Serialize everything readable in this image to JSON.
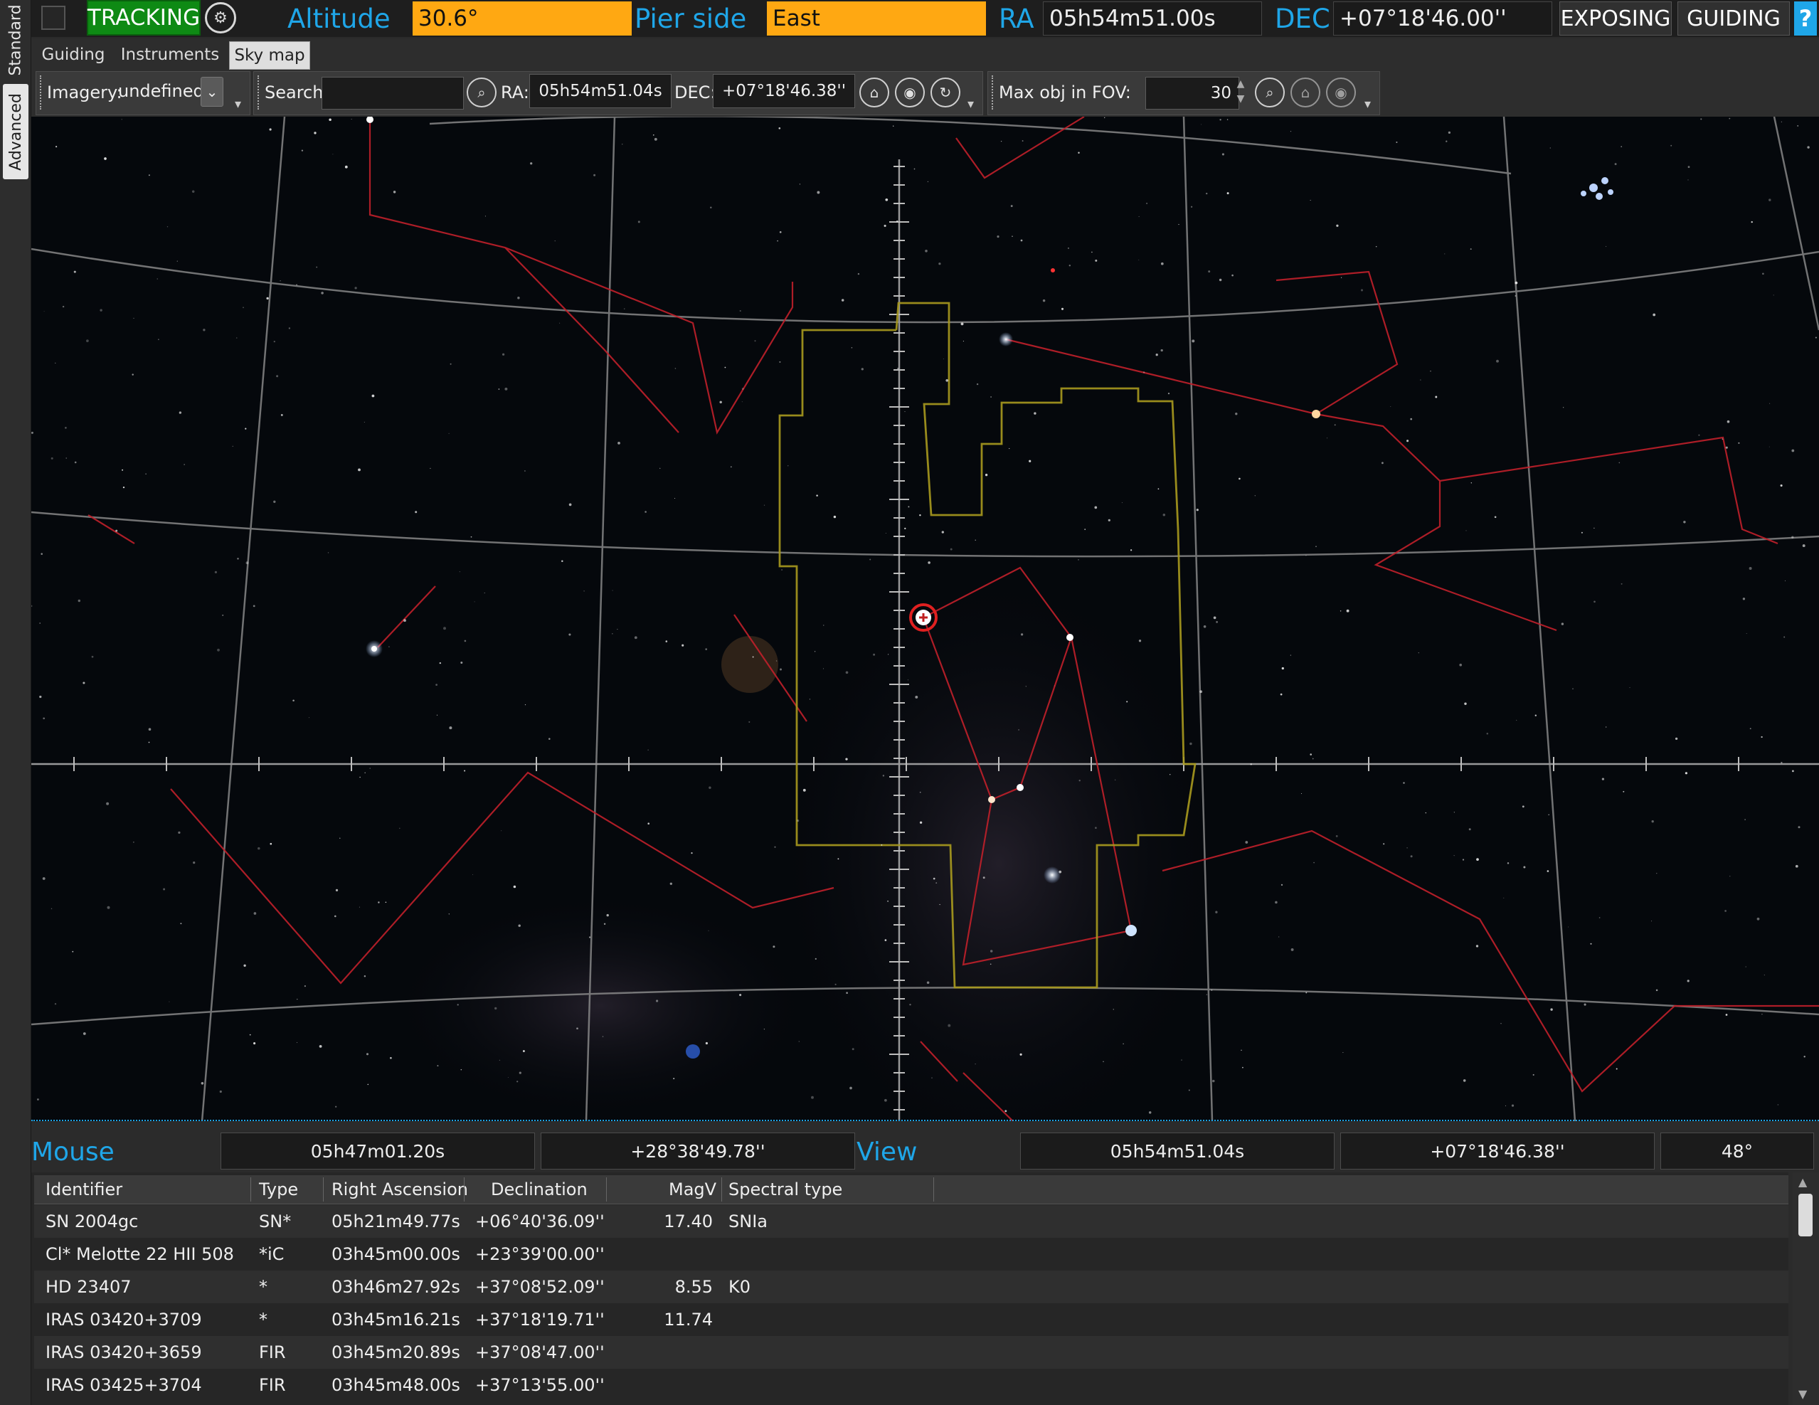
{
  "side_tabs": [
    "Standard",
    "Advanced"
  ],
  "status": {
    "tracking": "TRACKING",
    "altitude_label": "Altitude",
    "altitude_value": "30.6°",
    "pier_label": "Pier side",
    "pier_value": "East",
    "ra_label": "RA",
    "ra_value": "05h54m51.00s",
    "dec_label": "DEC",
    "dec_value": "+07°18'46.00''",
    "exposing": "EXPOSING",
    "guiding": "GUIDING",
    "help": "?"
  },
  "sub_tabs": [
    "Guiding",
    "Instruments",
    "Sky map"
  ],
  "toolbar": {
    "imagery_label": "Imagery:",
    "imagery_value": "undefined",
    "search_label": "Search:",
    "search_value": "",
    "ra_label": "RA:",
    "ra_value": "05h54m51.04s",
    "dec_label": "DEC:",
    "dec_value": "+07°18'46.38''",
    "maxobj_label": "Max obj in FOV:",
    "maxobj_value": "30"
  },
  "readout": {
    "mouse_label": "Mouse",
    "mouse_ra": "05h47m01.20s",
    "mouse_dec": "+28°38'49.78''",
    "view_label": "View",
    "view_ra": "05h54m51.04s",
    "view_dec": "+07°18'46.38''",
    "view_fov": "48°"
  },
  "table": {
    "headers": [
      "Identifier",
      "Type",
      "Right Ascension",
      "Declination",
      "MagV",
      "Spectral type"
    ],
    "rows": [
      [
        "SN 2004gc",
        "SN*",
        "05h21m49.77s",
        "+06°40'36.09''",
        "17.40",
        "SNIa"
      ],
      [
        "Cl* Melotte 22 HII 508",
        "*iC",
        "03h45m00.00s",
        "+23°39'00.00''",
        "",
        ""
      ],
      [
        "HD 23407",
        "*",
        "03h46m27.92s",
        "+37°08'52.09''",
        "8.55",
        "K0"
      ],
      [
        "IRAS 03420+3709",
        "*",
        "03h45m16.21s",
        "+37°18'19.71''",
        "11.74",
        ""
      ],
      [
        "IRAS 03420+3659",
        "FIR",
        "03h45m20.89s",
        "+37°08'47.00''",
        "",
        ""
      ],
      [
        "IRAS 03425+3704",
        "FIR",
        "03h45m48.00s",
        "+37°13'55.00''",
        "",
        ""
      ]
    ]
  },
  "colors": {
    "tracking_green": "#0e8a14",
    "status_orange": "#ffa812",
    "label_blue": "#1fa6e8",
    "constellation_red": "#c0202a",
    "boundary_yellow": "#a89a1e"
  }
}
